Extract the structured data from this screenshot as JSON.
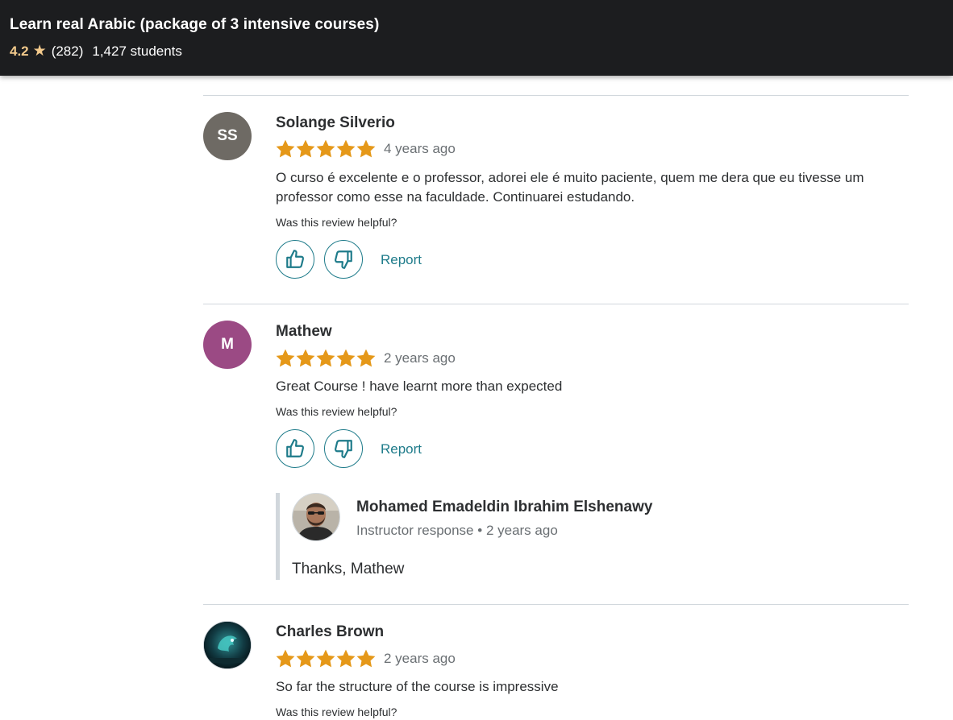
{
  "header": {
    "course_title": "Learn real Arabic (package of 3 intensive courses)",
    "rating": "4.2",
    "star_icon": "star-icon",
    "rating_count": "(282)",
    "students": "1,427 students"
  },
  "reviews": [
    {
      "initials": "SS",
      "avatar_color": "#6e6a64",
      "name": "Solange Silverio",
      "stars": 5,
      "time": "4 years ago",
      "text": "O curso é excelente e o professor, adorei ele é muito paciente, quem me dera que eu tivesse um professor como esse na faculdade. Continuarei estudando.",
      "helpful_prompt": "Was this review helpful?",
      "report_label": "Report"
    },
    {
      "initials": "M",
      "avatar_color": "#9b4a84",
      "name": "Mathew",
      "stars": 5,
      "time": "2 years ago",
      "text": "Great Course ! have learnt more than expected",
      "helpful_prompt": "Was this review helpful?",
      "report_label": "Report",
      "response": {
        "name": "Mohamed Emadeldin Ibrahim Elshenawy",
        "role": "Instructor response",
        "time": "2 years ago",
        "text": "Thanks, Mathew"
      }
    },
    {
      "name": "Charles Brown",
      "stars": 5,
      "time": "2 years ago",
      "text": "So far the structure of the course is impressive",
      "helpful_prompt": "Was this review helpful?"
    }
  ],
  "colors": {
    "star": "#e59819",
    "accent": "#1e7b8a",
    "header_bg": "#1c1d1f",
    "header_star": "#f3ca8c"
  },
  "icons": [
    "thumbs-up-icon",
    "thumbs-down-icon",
    "star-icon"
  ]
}
